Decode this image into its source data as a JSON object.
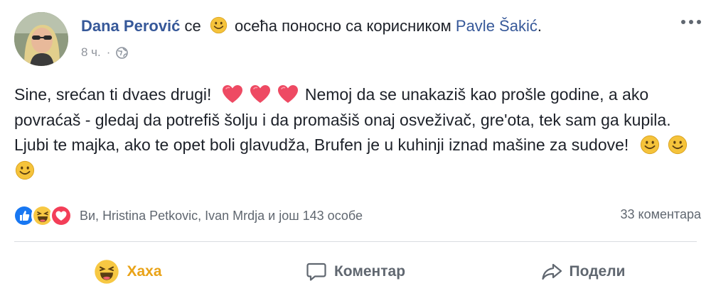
{
  "post": {
    "author": "Dana Perović",
    "verb_pre": "се",
    "feeling": "осећа поносно са корисником",
    "tagged": "Pavle Šakić",
    "tagged_suffix": ".",
    "time": "8 ч.",
    "privacy_icon": "globe-icon",
    "text_segments": [
      "Sine, srećan ti dvaes drugi!",
      "Nemoj da se unakaziš kao prošle godine, a ako povraćaš - gledaj da potrefiš šolju i da promašiš onaj osveživač, gre'ota, tek sam ga kupila. Ljubi te majka, ako te opet boli glavudža, Brufen je u kuhinji iznad mašine za sudove!"
    ]
  },
  "reactions": {
    "icons": [
      "like-icon",
      "haha-icon",
      "love-icon"
    ],
    "names": "Ви, Hristina Petkovic, Ivan Mrdja и још 143 особе",
    "comments": "33 коментара"
  },
  "actions": {
    "haha_label": "Хаха",
    "comment_label": "Коментар",
    "share_label": "Подели"
  },
  "colors": {
    "link": "#365899",
    "muted": "#606770",
    "haha_active": "#e9a318",
    "love": "#f33e58",
    "like": "#1877f2"
  }
}
